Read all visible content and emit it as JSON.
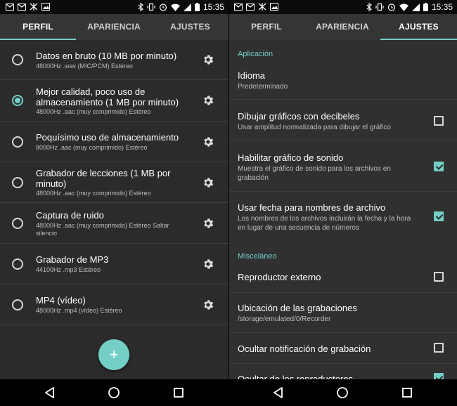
{
  "status_bar": {
    "time": "15:35",
    "left_icons": [
      "gmail-icon",
      "gmail-icon",
      "network-icon",
      "gallery-icon"
    ],
    "right_icons": [
      "bluetooth-icon",
      "vibrate-icon",
      "alarm-icon",
      "wifi-icon",
      "signal-icon",
      "battery-icon"
    ]
  },
  "tabs": {
    "perfil": "PERFIL",
    "apariencia": "APARIENCIA",
    "ajustes": "AJUSTES"
  },
  "left_active_tab": "perfil",
  "right_active_tab": "ajustes",
  "profiles": [
    {
      "title": "Datos en bruto (10 MB por minuto)",
      "subtitle": "48000Hz .wav (MIC/PCM) Estéreo",
      "selected": false
    },
    {
      "title": "Mejor calidad, poco uso de almacenamiento (1 MB por minuto)",
      "subtitle": "48000Hz .aac (muy comprimido) Estéreo",
      "selected": true
    },
    {
      "title": "Poquísimo uso de almacenamiento",
      "subtitle": "8000Hz .aac (muy comprimido) Estéreo",
      "selected": false
    },
    {
      "title": "Grabador de lecciones (1 MB por minuto)",
      "subtitle": "48000Hz .aac (muy comprimido) Estéreo",
      "selected": false
    },
    {
      "title": "Captura de ruido",
      "subtitle": "48000Hz .aac (muy comprimido) Estéreo  Saltar silencio",
      "selected": false
    },
    {
      "title": "Grabador de MP3",
      "subtitle": "44100Hz .mp3 Estéreo",
      "selected": false
    },
    {
      "title": "MP4 (vídeo)",
      "subtitle": "48000Hz .mp4 (vídeo) Estéreo",
      "selected": false
    }
  ],
  "fab_label": "+",
  "settings": {
    "section_app": "Aplicación",
    "idioma": {
      "title": "Idioma",
      "subtitle": "Predeterminado"
    },
    "decibeles": {
      "title": "Dibujar gráficos con decibeles",
      "subtitle": "Usar amplitud normalizada para dibujar el gráfico",
      "checked": false
    },
    "grafico": {
      "title": "Habilitar gráfico de sonido",
      "subtitle": "Muestra el gráfico de sonido para los archivos en grabación",
      "checked": true
    },
    "fecha": {
      "title": "Usar fecha para nombres de archivo",
      "subtitle": "Los nombres de los archivos incluirán la fecha y la hora en lugar de una secuencia de números",
      "checked": true
    },
    "section_misc": "Misceláneo",
    "reproductor": {
      "title": "Reproductor externo",
      "checked": false
    },
    "ubicacion": {
      "title": "Ubicación de las grabaciones",
      "subtitle": "/storage/emulated/0/Recorder"
    },
    "notificacion": {
      "title": "Ocultar notificación de grabación",
      "checked": false
    },
    "reproductores": {
      "title": "Ocultar de los reproductores",
      "checked": true
    }
  },
  "colors": {
    "accent": "#73cfc6",
    "background": "#2b2b2b",
    "tabbar": "#353535"
  }
}
